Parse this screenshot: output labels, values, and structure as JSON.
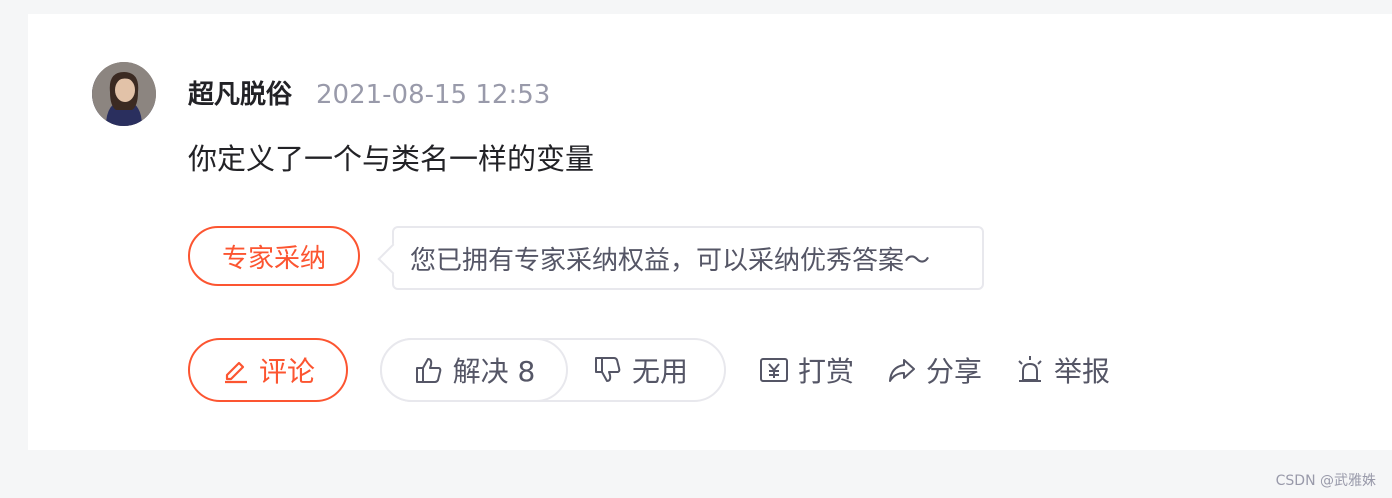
{
  "comment": {
    "author": "超凡脱俗",
    "time": "2021-08-15 12:53",
    "content": "你定义了一个与类名一样的变量"
  },
  "expert": {
    "adopt_label": "专家采纳",
    "tip": "您已拥有专家采纳权益，可以采纳优秀答案～"
  },
  "actions": {
    "comment_label": "评论",
    "solve_label": "解决 8",
    "useless_label": "无用",
    "reward_label": "打赏",
    "share_label": "分享",
    "report_label": "举报"
  },
  "icons": {
    "comment": "pencil-icon",
    "solve": "thumbs-up-icon",
    "useless": "thumbs-down-icon",
    "reward": "yen-icon",
    "share": "share-icon",
    "report": "alarm-icon"
  },
  "colors": {
    "accent": "#fc5531",
    "text": "#222226",
    "muted": "#999aaa",
    "secondary": "#555666",
    "border": "#e8e8ed"
  },
  "watermark": "CSDN @武雅姝"
}
